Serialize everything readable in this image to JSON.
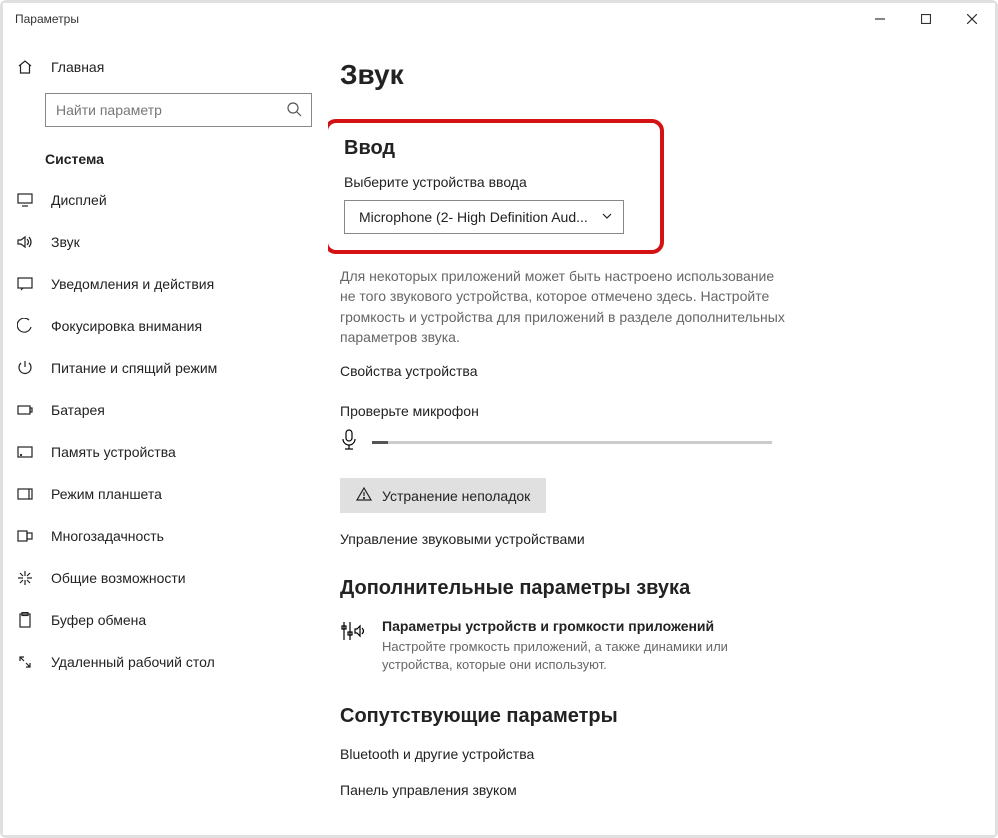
{
  "window": {
    "title": "Параметры"
  },
  "sidebar": {
    "home": "Главная",
    "search_placeholder": "Найти параметр",
    "section": "Система",
    "items": [
      {
        "label": "Дисплей"
      },
      {
        "label": "Звук"
      },
      {
        "label": "Уведомления и действия"
      },
      {
        "label": "Фокусировка внимания"
      },
      {
        "label": "Питание и спящий режим"
      },
      {
        "label": "Батарея"
      },
      {
        "label": "Память устройства"
      },
      {
        "label": "Режим планшета"
      },
      {
        "label": "Многозадачность"
      },
      {
        "label": "Общие возможности"
      },
      {
        "label": "Буфер обмена"
      },
      {
        "label": "Удаленный рабочий стол"
      }
    ]
  },
  "main": {
    "title": "Звук",
    "input_section": {
      "heading": "Ввод",
      "select_label": "Выберите устройства ввода",
      "selected_device": "Microphone (2- High Definition Aud..."
    },
    "help": "Для некоторых приложений может быть настроено использование не того звукового устройства, которое отмечено здесь. Настройте громкость и устройства для приложений в разделе дополнительных параметров звука.",
    "device_props": "Свойства устройства",
    "test_mic": "Проверьте микрофон",
    "troubleshoot": "Устранение неполадок",
    "manage_devices": "Управление звуковыми устройствами",
    "advanced": {
      "heading": "Дополнительные параметры звука",
      "item_title": "Параметры устройств и громкости приложений",
      "item_desc": "Настройте громкость приложений, а также динамики или устройства, которые они используют."
    },
    "related": {
      "heading": "Сопутствующие параметры",
      "item1": "Bluetooth и другие устройства",
      "item2": "Панель управления звуком"
    }
  }
}
